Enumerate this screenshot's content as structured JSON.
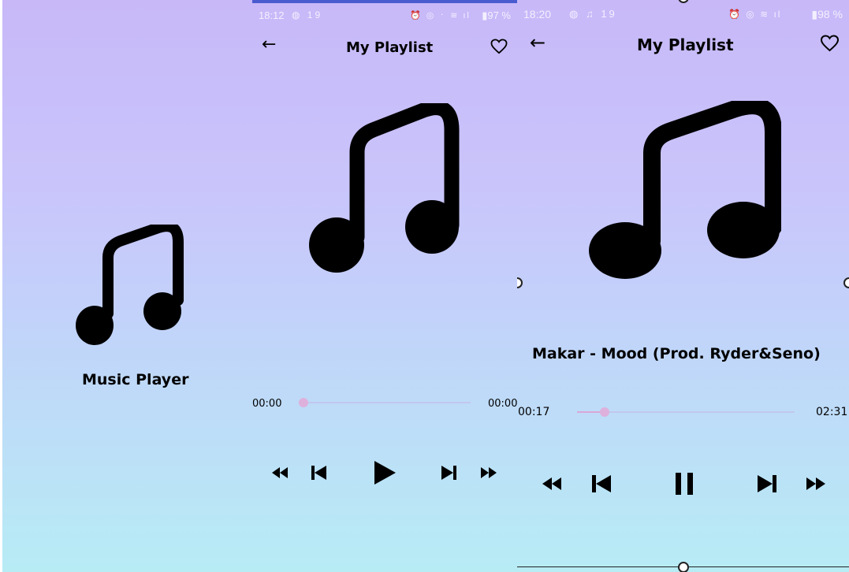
{
  "splash": {
    "title": "Music Player",
    "icon": "music-note-icon"
  },
  "player_idle": {
    "status_bar": {
      "time": "18:12",
      "left_icons": "◍ 19",
      "right_icons": "⏰ ◎ ᛫ ≋ ıl",
      "battery": "▮97 %"
    },
    "header": {
      "back_icon": "arrow-left-icon",
      "back_glyph": "←",
      "title": "My Playlist",
      "favorite_icon": "heart-outline-icon",
      "favorite_glyph": "♡"
    },
    "progress": {
      "current": "00:00",
      "total": "00:00",
      "fraction": 0.0
    },
    "controls": [
      "fast-rewind-icon",
      "skip-previous-icon",
      "play-icon",
      "skip-next-icon",
      "fast-forward-icon"
    ]
  },
  "player_playing": {
    "status_bar": {
      "time": "18:20",
      "left_icons": "◍ ♫ 19",
      "right_icons": "⏰ ◎ ≋ ıl",
      "battery": "▮98 %"
    },
    "header": {
      "back_icon": "arrow-left-icon",
      "back_glyph": "←",
      "title": "My Playlist",
      "favorite_icon": "heart-outline-icon",
      "favorite_glyph": "♡"
    },
    "song_title": "Makar - Mood (Prod. Ryder&Seno)",
    "progress": {
      "current": "00:17",
      "total": "02:31",
      "fraction": 0.11
    },
    "controls": [
      "fast-rewind-icon",
      "skip-previous-icon",
      "pause-icon",
      "skip-next-icon",
      "fast-forward-icon"
    ]
  },
  "colors": {
    "gradient_top": "#c8b8f8",
    "gradient_bottom": "#b7ecf5",
    "slider_thumb": "#ddb1dc",
    "status_bar_accent": "#4a5bd0"
  }
}
